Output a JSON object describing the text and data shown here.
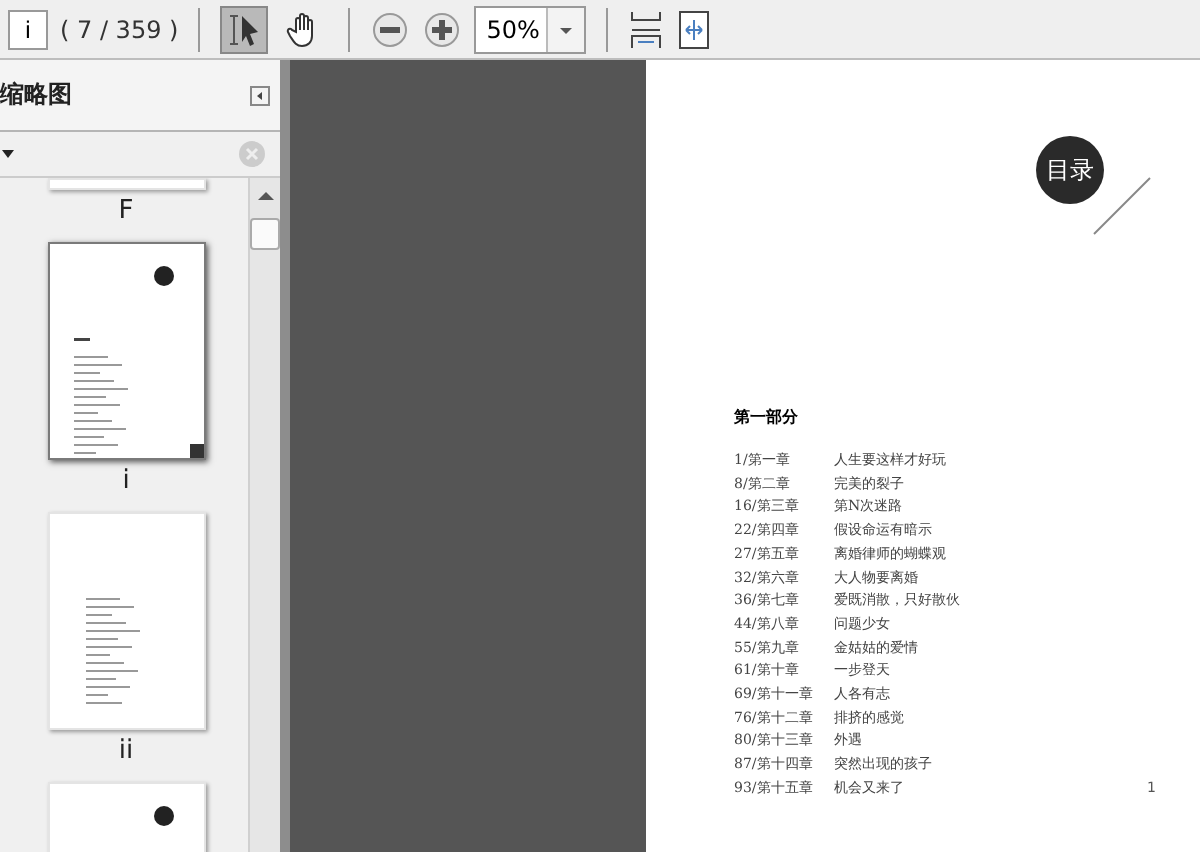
{
  "toolbar": {
    "page_field": {
      "value": "i"
    },
    "page_count": "( 7 / 359 )",
    "tools": [
      {
        "kind": "select",
        "selected": true
      },
      {
        "kind": "hand",
        "selected": false
      }
    ],
    "zoom": {
      "value": "50%"
    }
  },
  "sidebar": {
    "title": "缩略图",
    "thumbnails": [
      {
        "label": "F",
        "kind": "cut",
        "selected": false
      },
      {
        "label": "i",
        "kind": "badge",
        "selected": true
      },
      {
        "label": "ii",
        "kind": "plain",
        "selected": false
      },
      {
        "kind": "badge",
        "selected": false
      }
    ]
  },
  "page": {
    "badge": "目录",
    "section": "第一部分",
    "entries": [
      {
        "num": "1/第一章",
        "title": "人生要这样才好玩"
      },
      {
        "num": "8/第二章",
        "title": "完美的裂子"
      },
      {
        "num": "16/第三章",
        "title": "第N次迷路"
      },
      {
        "num": "22/第四章",
        "title": "假设命运有暗示"
      },
      {
        "num": "27/第五章",
        "title": "离婚律师的蝴蝶观"
      },
      {
        "num": "32/第六章",
        "title": "大人物要离婚"
      },
      {
        "num": "36/第七章",
        "title": "爱既消散，只好散伙"
      },
      {
        "num": "44/第八章",
        "title": "问题少女"
      },
      {
        "num": "55/第九章",
        "title": "金姑姑的爱情"
      },
      {
        "num": "61/第十章",
        "title": "一步登天"
      },
      {
        "num": "69/第十一章",
        "title": "人各有志"
      },
      {
        "num": "76/第十二章",
        "title": "排挤的感觉"
      },
      {
        "num": "80/第十三章",
        "title": "外遇"
      },
      {
        "num": "87/第十四章",
        "title": "突然出现的孩子"
      },
      {
        "num": "93/第十五章",
        "title": "机会又来了"
      }
    ],
    "page_number": "1"
  }
}
